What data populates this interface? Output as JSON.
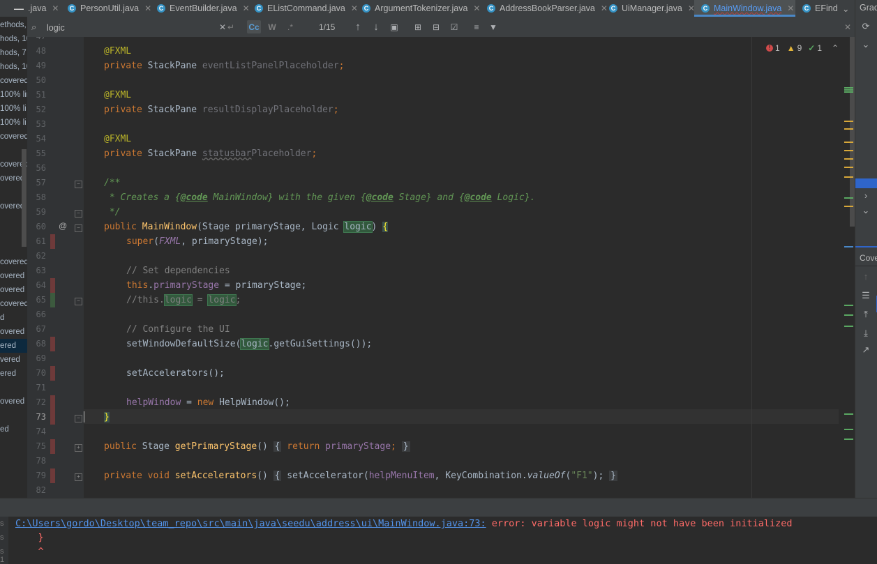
{
  "tabs": [
    {
      "label": ".java",
      "icon": "class-icon",
      "partial": true
    },
    {
      "label": "PersonUtil.java",
      "icon": "class-icon"
    },
    {
      "label": "EventBuilder.java",
      "icon": "class-icon"
    },
    {
      "label": "EListCommand.java",
      "icon": "class-icon"
    },
    {
      "label": "ArgumentTokenizer.java",
      "icon": "class-icon"
    },
    {
      "label": "AddressBookParser.java",
      "icon": "class-icon"
    },
    {
      "label": "UiManager.java",
      "icon": "class-icon"
    },
    {
      "label": "MainWindow.java",
      "icon": "class-icon",
      "active": true
    },
    {
      "label": "EFind",
      "icon": "class-icon",
      "partial": true
    }
  ],
  "gradle_label": "Grad",
  "left_panel": [
    "ethods,",
    "hods, 10",
    "hods, 7",
    "hods, 10",
    "covered",
    "100% lin",
    "100% li",
    "100% li",
    "covered",
    "covered",
    "overed",
    "overed",
    "covered",
    "overed",
    "overed",
    "covered",
    "d",
    "overed",
    "ered",
    "vered",
    "ered",
    "overed",
    "ed",
    "ered"
  ],
  "search": {
    "value": "logic",
    "match_count": "1/15",
    "case_label": "Cc",
    "words_label": "W",
    "regex_label": ".*"
  },
  "inspections": {
    "errors": "1",
    "warnings": "9",
    "weak": "1"
  },
  "code_lines": [
    {
      "n": "48"
    },
    {
      "n": "49"
    },
    {
      "n": "50"
    },
    {
      "n": "51"
    },
    {
      "n": "52"
    },
    {
      "n": "53"
    },
    {
      "n": "54"
    },
    {
      "n": "55"
    },
    {
      "n": "56"
    },
    {
      "n": "57"
    },
    {
      "n": "58"
    },
    {
      "n": "59"
    },
    {
      "n": "60"
    },
    {
      "n": "61"
    },
    {
      "n": "62"
    },
    {
      "n": "63"
    },
    {
      "n": "64"
    },
    {
      "n": "65"
    },
    {
      "n": "66"
    },
    {
      "n": "67"
    },
    {
      "n": "68"
    },
    {
      "n": "69"
    },
    {
      "n": "70"
    },
    {
      "n": "71"
    },
    {
      "n": "72"
    },
    {
      "n": "73"
    },
    {
      "n": "74"
    },
    {
      "n": "75"
    },
    {
      "n": "78"
    },
    {
      "n": "79"
    },
    {
      "n": "82"
    }
  ],
  "code": {
    "l48": {
      "ann": "@FXML"
    },
    "l49": {
      "kw": "private",
      "type": "StackPane",
      "field": "eventListPanelPlaceholder",
      "end": ";"
    },
    "l51": {
      "ann": "@FXML"
    },
    "l52": {
      "kw": "private",
      "type": "StackPane",
      "field": "resultDisplayPlaceholder",
      "end": ";"
    },
    "l54": {
      "ann": "@FXML"
    },
    "l55": {
      "kw": "private",
      "type": "StackPane",
      "field_a": "statusbar",
      "field_b": "Placeholder",
      "end": ";"
    },
    "l57": {
      "text": "/**"
    },
    "l58": {
      "a": " * Creates a {",
      "t1": "@code",
      "b": " MainWindow} with the given {",
      "t2": "@code",
      "c": " Stage} and {",
      "t3": "@code",
      "d": " Logic}."
    },
    "l59": {
      "text": " */"
    },
    "l60": {
      "kw": "public",
      "name": "MainWindow",
      "a": "(Stage primaryStage, Logic ",
      "param": "logic",
      "b": ") ",
      "brace": "{"
    },
    "l61": {
      "kw": "super",
      "a": "(",
      "const": "FXML",
      "b": ", primaryStage);"
    },
    "l63": {
      "text": "// Set dependencies"
    },
    "l64": {
      "kw": "this",
      "a": ".",
      "field": "primaryStage",
      "b": " = primaryStage;"
    },
    "l65": {
      "a": "//this.",
      "h1": "logic",
      "b": " = ",
      "h2": "logic",
      "c": ";"
    },
    "l67": {
      "text": "// Configure the UI"
    },
    "l68": {
      "a": "setWindowDefaultSize(",
      "h": "logic",
      "b": ".getGuiSettings());"
    },
    "l70": {
      "text": "setAccelerators();"
    },
    "l72": {
      "field": "helpWindow",
      "a": " = ",
      "kw": "new",
      "b": " HelpWindow();"
    },
    "l73": {
      "brace": "}"
    },
    "l75": {
      "kw": "public",
      "type": " Stage ",
      "name": "getPrimaryStage",
      "a": "() ",
      "box1": "{",
      "kw2": " return ",
      "field": "primaryStage",
      "end": ";",
      "box2": "}"
    },
    "l79": {
      "kw": "private",
      "kw2": " void ",
      "name": "setAccelerators",
      "a": "() ",
      "box1": "{",
      "b": " setAccelerator(",
      "field": "helpMenuItem",
      "c": ", KeyCombination.",
      "it": "valueOf",
      "d": "(",
      "str": "\"F1\"",
      "e": ");",
      "box2": "}"
    }
  },
  "right_panel": {
    "title": "Cove"
  },
  "console": {
    "path": "C:\\Users\\gordo\\Desktop\\team_repo\\src\\main\\java\\seedu\\address\\ui\\MainWindow.java:73:",
    "message": " error: variable logic might not have been initialized",
    "line2": "    }",
    "line3": "    ^",
    "gutter": [
      "s",
      "s",
      "s 1"
    ]
  },
  "colors": {
    "keyword": "#cc7832",
    "annotation": "#bbb529",
    "field": "#9876aa",
    "method": "#ffc66d",
    "doc": "#629755",
    "error": "#ff6b68",
    "link": "#5394ec",
    "accent": "#4a88c7"
  }
}
